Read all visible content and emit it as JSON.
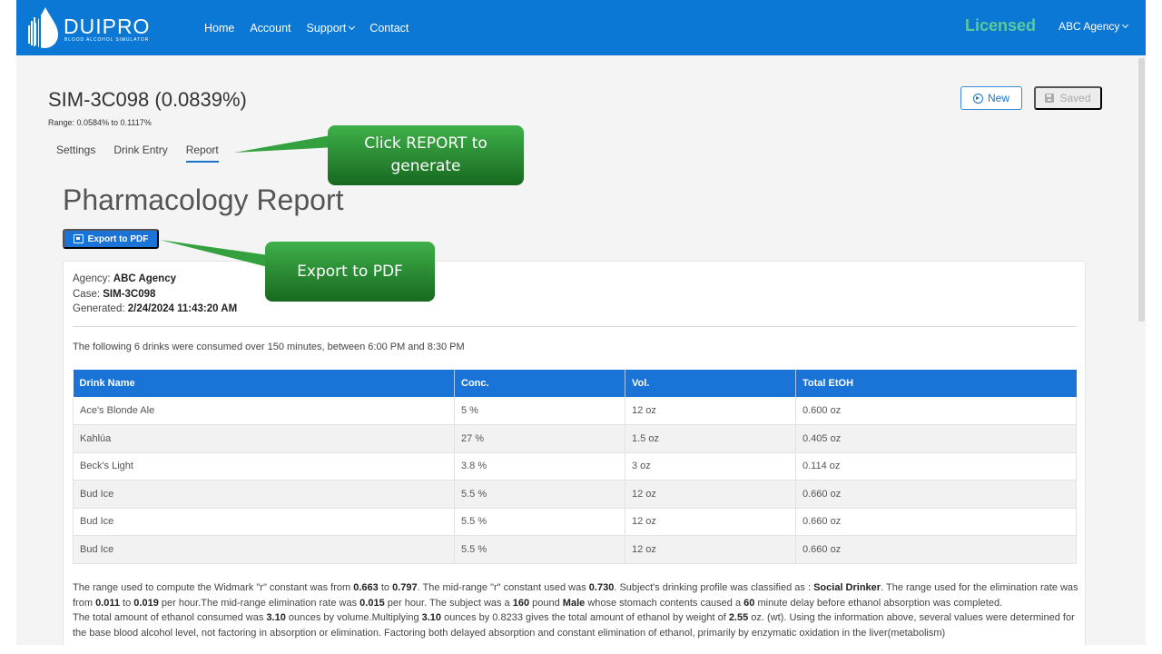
{
  "navbar": {
    "logo_title": "DUIPRO",
    "logo_subtitle": "BLOOD ALCOHOL SIMULATOR",
    "links": [
      {
        "label": "Home"
      },
      {
        "label": "Account"
      },
      {
        "label": "Support",
        "has_dropdown": true
      },
      {
        "label": "Contact"
      }
    ],
    "license_status": "Licensed",
    "account_menu": "ABC Agency",
    "colors": {
      "bar": "#0b78d6",
      "licensed": "#5cc99a"
    }
  },
  "header": {
    "sim_title": "SIM-3C098 (0.0839%)",
    "range": "Range: 0.0584% to 0.1117%",
    "new_button": "New",
    "saved_button": "Saved",
    "tabs": [
      {
        "label": "Settings",
        "active": false
      },
      {
        "label": "Drink Entry",
        "active": false
      },
      {
        "label": "Report",
        "active": true
      }
    ]
  },
  "callouts": {
    "report": "Click REPORT to generate",
    "export": "Export to PDF"
  },
  "report": {
    "heading": "Pharmacology Report",
    "export_button": "Export to PDF",
    "meta": {
      "agency_label": "Agency:",
      "agency_value": "ABC Agency",
      "case_label": "Case:",
      "case_value": "SIM-3C098",
      "generated_label": "Generated:",
      "generated_value": "2/24/2024 11:43:20 AM"
    },
    "summary": "The following 6 drinks were consumed over 150 minutes, between 6:00 PM and 8:30 PM",
    "table": {
      "columns": [
        "Drink Name",
        "Conc.",
        "Vol.",
        "Total EtOH"
      ],
      "rows": [
        [
          "Ace's Blonde Ale",
          "5 %",
          "12 oz",
          "0.600 oz"
        ],
        [
          "Kahlúa",
          "27 %",
          "1.5 oz",
          "0.405 oz"
        ],
        [
          "Beck's Light",
          "3.8 %",
          "3 oz",
          "0.114 oz"
        ],
        [
          "Bud Ice",
          "5.5 %",
          "12 oz",
          "0.660 oz"
        ],
        [
          "Bud Ice",
          "5.5 %",
          "12 oz",
          "0.660 oz"
        ],
        [
          "Bud Ice",
          "5.5 %",
          "12 oz",
          "0.660 oz"
        ]
      ]
    },
    "narrative": {
      "p1": [
        {
          "t": "The range used to compute the Widmark \"r\" constant was from "
        },
        {
          "t": "0.663",
          "b": true
        },
        {
          "t": " to "
        },
        {
          "t": "0.797",
          "b": true
        },
        {
          "t": ". The mid-range \"r\" constant used was "
        },
        {
          "t": "0.730",
          "b": true
        },
        {
          "t": ". Subject's drinking profile was classified as : "
        },
        {
          "t": "Social Drinker",
          "b": true
        },
        {
          "t": ". The range used for the elimination rate was from "
        },
        {
          "t": "0.011",
          "b": true
        },
        {
          "t": " to "
        },
        {
          "t": "0.019",
          "b": true
        },
        {
          "t": " per hour.The mid-range elimination rate was "
        },
        {
          "t": "0.015",
          "b": true
        },
        {
          "t": " per hour. The subject was a "
        },
        {
          "t": "160",
          "b": true
        },
        {
          "t": " pound "
        },
        {
          "t": "Male",
          "b": true
        },
        {
          "t": " whose stomach contents caused a "
        },
        {
          "t": "60",
          "b": true
        },
        {
          "t": " minute delay before ethanol absorption was completed."
        }
      ],
      "p2": [
        {
          "t": "The total amount of ethanol consumed was "
        },
        {
          "t": "3.10",
          "b": true
        },
        {
          "t": " ounces by volume.Multiplying "
        },
        {
          "t": "3.10",
          "b": true
        },
        {
          "t": " ounces by 0.8233 gives the total amount of ethanol by weight of "
        },
        {
          "t": "2.55",
          "b": true
        },
        {
          "t": " oz. (wt). Using the information above, several values were determined for the base blood alcohol level, not factoring in absorption or elimination. Factoring both delayed absorption and constant elimination of ethanol, primarily by enzymatic oxidation in the liver(metabolism)"
        }
      ]
    }
  }
}
